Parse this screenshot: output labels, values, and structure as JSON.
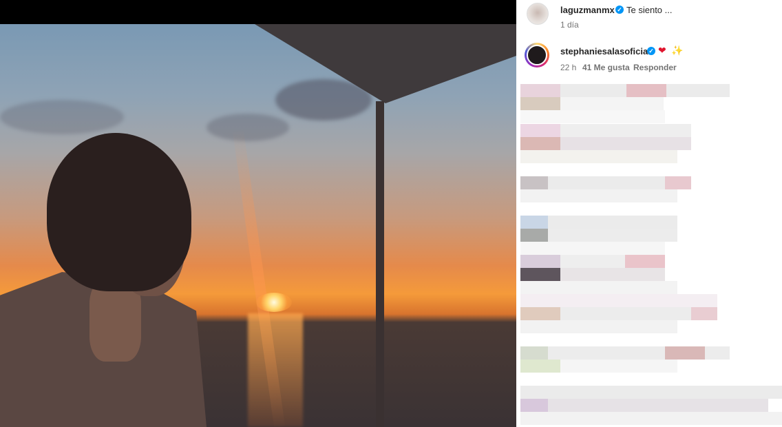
{
  "comments": [
    {
      "username": "laguzmanmx",
      "text": "Te siento ...",
      "time": "1 día"
    },
    {
      "username": "stephaniesalasoficial",
      "emojis": [
        "heart",
        "sparkles"
      ],
      "time": "22 h",
      "likes": "41 Me gusta",
      "reply": "Responder"
    }
  ],
  "icons": {
    "verified": "✓",
    "heart": "❤",
    "sparkles": "✨"
  }
}
